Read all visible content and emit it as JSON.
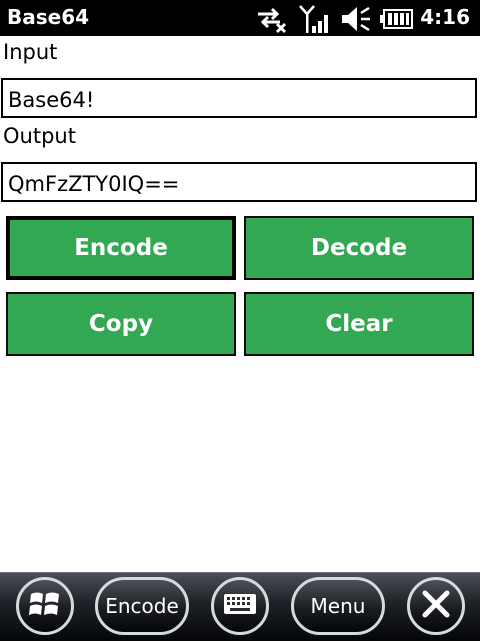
{
  "status_bar": {
    "title": "Base64",
    "time": "4:16",
    "icons": [
      "data-sync-off-icon",
      "signal-strength-icon",
      "volume-muted-icon",
      "battery-icon"
    ]
  },
  "form": {
    "input_label": "Input",
    "input_value": "Base64!",
    "output_label": "Output",
    "output_value": "QmFzZTY0IQ=="
  },
  "buttons": {
    "encode": "Encode",
    "decode": "Decode",
    "copy": "Copy",
    "clear": "Clear"
  },
  "softkeys": {
    "left": "Encode",
    "right": "Menu",
    "icons": [
      "windows-start-icon",
      "keyboard-icon",
      "close-icon"
    ]
  },
  "colors": {
    "button_green": "#33a852",
    "status_bar": "#000000"
  }
}
